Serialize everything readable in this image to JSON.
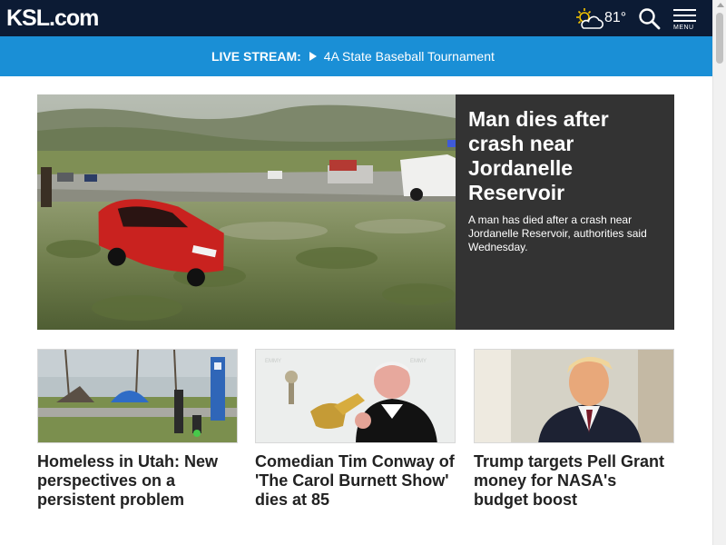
{
  "header": {
    "logo_text": "KSL.com",
    "weather": {
      "temperature": "81°",
      "icon": "partly-sunny-icon"
    },
    "search_icon": "search-icon",
    "menu_label": "MENU",
    "colors": {
      "background": "#0c1b34"
    }
  },
  "live_stream": {
    "label": "LIVE STREAM:",
    "title": "4A State Baseball Tournament",
    "colors": {
      "background": "#1a8fd6"
    }
  },
  "hero": {
    "title": "Man dies after crash near Jordanelle Reservoir",
    "summary": "A man has died after a crash near Jordanelle Reservoir, authorities said Wednesday.",
    "colors": {
      "panel": "#333333"
    }
  },
  "stories": [
    {
      "title": "Homeless in Utah: New perspectives on a persistent problem"
    },
    {
      "title": "Comedian Tim Conway of 'The Carol Burnett Show' dies at 85"
    },
    {
      "title": "Trump targets Pell Grant money for NASA's budget boost"
    }
  ]
}
